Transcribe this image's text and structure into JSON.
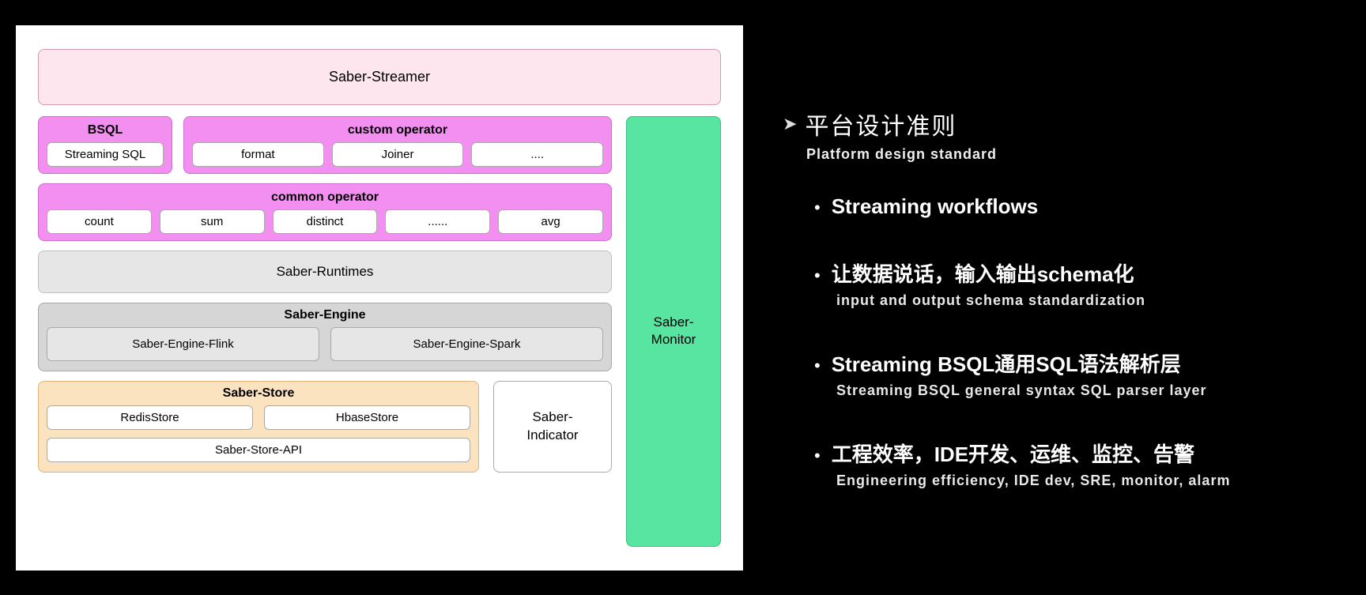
{
  "diagram": {
    "streamer": "Saber-Streamer",
    "bsql": {
      "title": "BSQL",
      "items": [
        "Streaming SQL"
      ]
    },
    "custom_operator": {
      "title": "custom operator",
      "items": [
        "format",
        "Joiner",
        "...."
      ]
    },
    "common_operator": {
      "title": "common operator",
      "items": [
        "count",
        "sum",
        "distinct",
        "......",
        "avg"
      ]
    },
    "runtimes": "Saber-Runtimes",
    "engine": {
      "title": "Saber-Engine",
      "items": [
        "Saber-Engine-Flink",
        "Saber-Engine-Spark"
      ]
    },
    "store": {
      "title": "Saber-Store",
      "top_items": [
        "RedisStore",
        "HbaseStore"
      ],
      "bottom_item": "Saber-Store-API"
    },
    "indicator": "Saber-\nIndicator",
    "monitor": "Saber-\nMonitor"
  },
  "right": {
    "heading_main": "平台设计准则",
    "heading_sub": "Platform design standard",
    "bullets": [
      {
        "main": "Streaming workflows",
        "sub": ""
      },
      {
        "main": "让数据说话，输入输出schema化",
        "sub": "input and output schema standardization"
      },
      {
        "main": "Streaming BSQL通用SQL语法解析层",
        "sub": "Streaming BSQL general syntax SQL parser layer"
      },
      {
        "main": "工程效率，IDE开发、运维、监控、告警",
        "sub": "Engineering efficiency, IDE dev, SRE, monitor, alarm"
      }
    ]
  }
}
